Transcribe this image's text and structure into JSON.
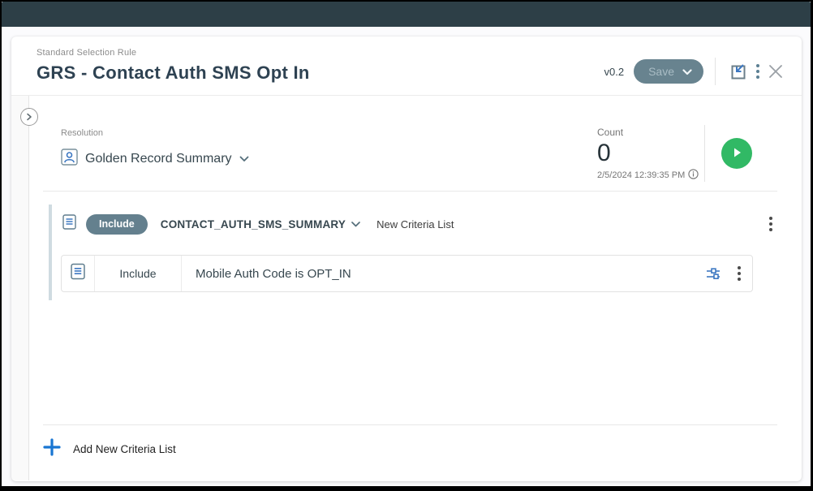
{
  "header": {
    "type_label": "Standard Selection Rule",
    "title": "GRS - Contact Auth SMS Opt In",
    "version": "v0.2",
    "save_label": "Save"
  },
  "resolution": {
    "label": "Resolution",
    "value": "Golden Record Summary"
  },
  "count": {
    "label": "Count",
    "value": "0",
    "timestamp": "2/5/2024 12:39:35 PM"
  },
  "criteria_list": {
    "include_badge": "Include",
    "dataset": "CONTACT_AUTH_SMS_SUMMARY",
    "list_name": "New Criteria List",
    "rows": [
      {
        "operator": "Include",
        "expression": "Mobile Auth Code is OPT_IN"
      }
    ]
  },
  "footer": {
    "add_label": "Add New Criteria List"
  },
  "icons": {
    "collapse": "chevron-right-circle",
    "resolution": "person-badge",
    "run": "play-circle",
    "info": "info-circle",
    "criteria": "document-lines",
    "filter": "sliders",
    "menu": "kebab",
    "edit": "open-window-arrow",
    "close": "x"
  },
  "colors": {
    "topbar": "#2d3f47",
    "accent_blue": "#1976d2",
    "icon_blue": "#3d78c2",
    "slate_pill": "#64808e",
    "save_button": "#68838f",
    "play_green": "#31b965",
    "title_text": "#2e4252",
    "criteria_accent": "#cfdbe1"
  }
}
